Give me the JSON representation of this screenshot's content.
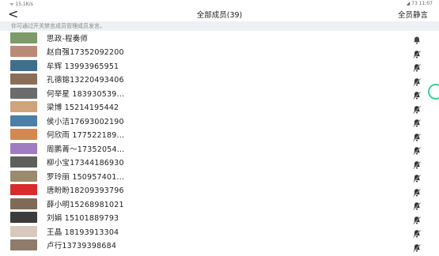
{
  "status": {
    "left": "ᯤ 15.1K/s",
    "right": "◢ 73 11:07"
  },
  "header": {
    "back": "<",
    "title": "全部成员(39)",
    "mute_all": "全员静言"
  },
  "notice": "你可通过开关禁言成员管理成员发言。",
  "members": [
    {
      "name": "思政-程奏师",
      "color": "#7c9a6a",
      "icon": "bell-icon"
    },
    {
      "name": "赵自强17352092200",
      "color": "#b98b76",
      "icon": "speaker-off-icon"
    },
    {
      "name": "牟辉 13993965951",
      "color": "#3e6f8e",
      "icon": "speaker-off-icon"
    },
    {
      "name": "孔德镕13220493406",
      "color": "#8b6e58",
      "icon": "speaker-off-icon"
    },
    {
      "name": "何举星 183930539...",
      "color": "#6b6b6b",
      "icon": "speaker-off-icon"
    },
    {
      "name": "梁博    15214195442",
      "color": "#cfa47a",
      "icon": "speaker-off-icon"
    },
    {
      "name": "侯小洁17693002190",
      "color": "#4b7fa6",
      "icon": "speaker-off-icon"
    },
    {
      "name": "何欣雨 177522189...",
      "color": "#d4874e",
      "icon": "speaker-off-icon"
    },
    {
      "name": "周鹏菁～17352054...",
      "color": "#a07cc0",
      "icon": "speaker-off-icon"
    },
    {
      "name": "柳小宝17344186930",
      "color": "#5f5e5b",
      "icon": "speaker-off-icon"
    },
    {
      "name": "罗玲丽 150957401...",
      "color": "#9a8b6e",
      "icon": "speaker-off-icon"
    },
    {
      "name": "唐盼盼18209393796",
      "color": "#d92b2b",
      "icon": "speaker-off-icon"
    },
    {
      "name": "薛小明15268981021",
      "color": "#7d6a58",
      "icon": "speaker-off-icon"
    },
    {
      "name": "刘娟   15101889793",
      "color": "#3c3c3c",
      "icon": "speaker-off-icon"
    },
    {
      "name": "王晶   18193913304",
      "color": "#d7c9bb",
      "icon": "speaker-off-icon"
    },
    {
      "name": "卢行13739398684",
      "color": "#8e7c6c",
      "icon": "speaker-off-icon"
    }
  ]
}
